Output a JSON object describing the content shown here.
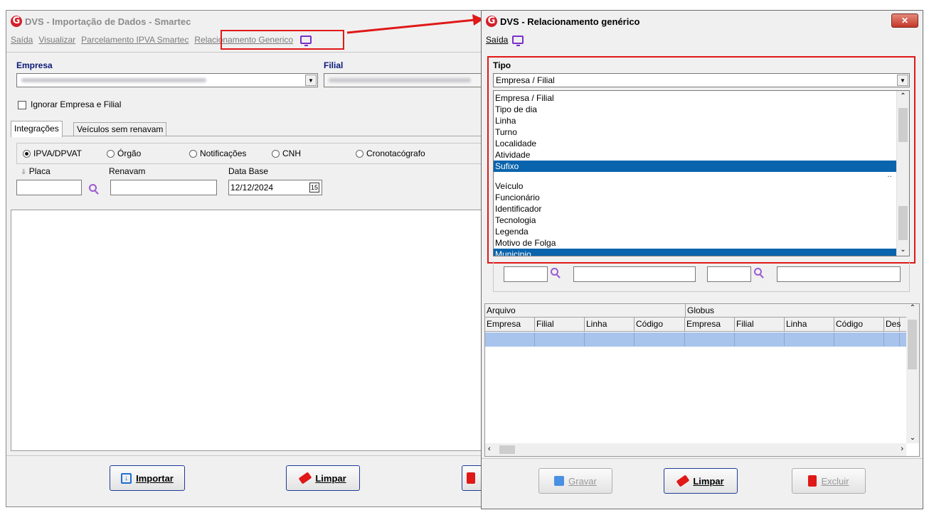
{
  "main_window": {
    "title": "DVS - Importação de Dados - Smartec",
    "menu": [
      "Saída",
      "Visualizar",
      "Parcelamento IPVA Smartec",
      "Relacionamento Generico"
    ],
    "empresa_label": "Empresa",
    "filial_label": "Filial",
    "ignorar_label": "Ignorar Empresa e Filial",
    "tabs": [
      "Integrações",
      "Veículos sem renavam"
    ],
    "radios": [
      "IPVA/DPVAT",
      "Órgão",
      "Notificações",
      "CNH",
      "Cronotacógrafo"
    ],
    "placa_label": "Placa",
    "renavam_label": "Renavam",
    "data_base_label": "Data Base",
    "data_base_value": "12/12/2024",
    "calendar_icon_text": "15",
    "importar_label": "Importar",
    "limpar_label": "Limpar"
  },
  "generic_window": {
    "title": "DVS - Relacionamento genérico",
    "menu_saida": "Saída",
    "close_label": "✕",
    "tipo_label": "Tipo",
    "tipo_value": "Empresa / Filial",
    "list_items": [
      {
        "label": "Empresa / Filial",
        "selected": false
      },
      {
        "label": "Tipo de dia",
        "selected": false
      },
      {
        "label": "Linha",
        "selected": false
      },
      {
        "label": "Turno",
        "selected": false
      },
      {
        "label": "Localidade",
        "selected": false
      },
      {
        "label": "Atividade",
        "selected": false
      },
      {
        "label": "Sufixo",
        "selected": true
      }
    ],
    "list_items_2": [
      {
        "label": "Veículo",
        "selected": false
      },
      {
        "label": "Funcionário",
        "selected": false
      },
      {
        "label": "Identificador",
        "selected": false
      },
      {
        "label": "Tecnologia",
        "selected": false
      },
      {
        "label": "Legenda",
        "selected": false
      },
      {
        "label": "Motivo de Folga",
        "selected": false
      },
      {
        "label": "Municipio",
        "selected": true
      }
    ],
    "grid_group_headers": [
      "Arquivo",
      "Globus"
    ],
    "grid_columns": [
      "Empresa",
      "Filial",
      "Linha",
      "Código",
      "Empresa",
      "Filial",
      "Linha",
      "Código",
      "Des"
    ],
    "gravar_label": "Gravar",
    "limpar_label": "Limpar",
    "excluir_label": "Excluir"
  },
  "colors": {
    "highlight_red": "#e01818",
    "selection_blue": "#0a64ad",
    "label_blue": "#0a1a78",
    "icon_purple": "#7b2fc9"
  }
}
